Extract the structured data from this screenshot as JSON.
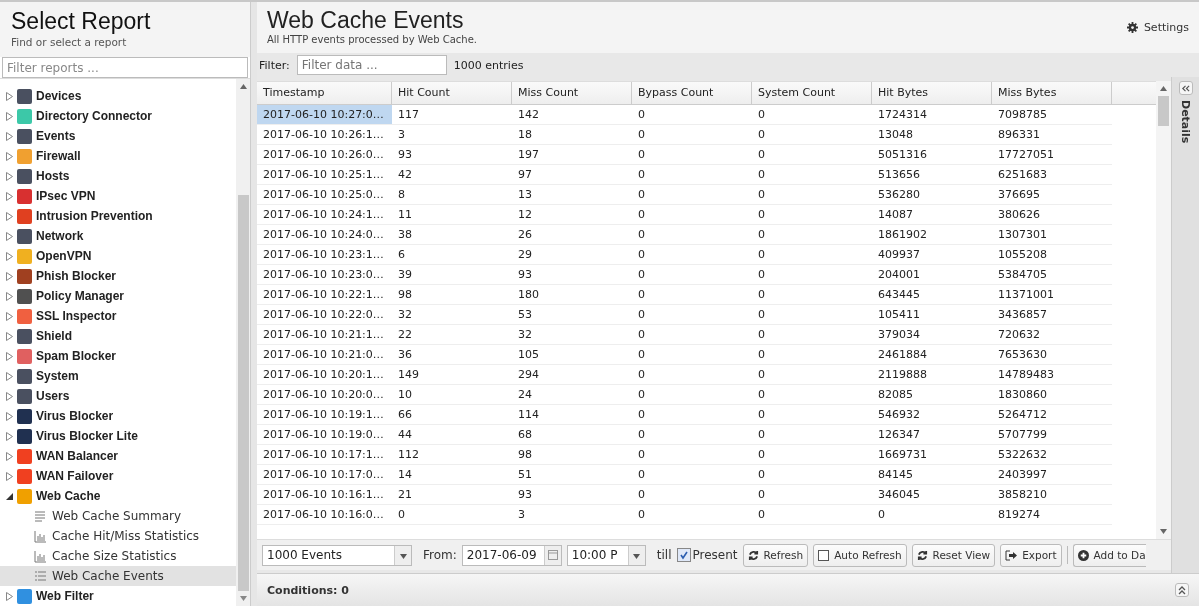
{
  "sidebar": {
    "title": "Select Report",
    "subtitle": "Find or select a report",
    "filter": {
      "placeholder": "Filter reports ..."
    },
    "items": [
      {
        "label": "Devices",
        "color": "#4a5060",
        "expanded": false
      },
      {
        "label": "Directory Connector",
        "color": "#3cc8a8",
        "expanded": false
      },
      {
        "label": "Events",
        "color": "#4a5060",
        "expanded": false
      },
      {
        "label": "Firewall",
        "color": "#f0a030",
        "expanded": false
      },
      {
        "label": "Hosts",
        "color": "#4a5060",
        "expanded": false
      },
      {
        "label": "IPsec VPN",
        "color": "#d83030",
        "expanded": false
      },
      {
        "label": "Intrusion Prevention",
        "color": "#e04020",
        "expanded": false
      },
      {
        "label": "Network",
        "color": "#4a5060",
        "expanded": false
      },
      {
        "label": "OpenVPN",
        "color": "#f0b020",
        "expanded": false
      },
      {
        "label": "Phish Blocker",
        "color": "#a04020",
        "expanded": false
      },
      {
        "label": "Policy Manager",
        "color": "#505050",
        "expanded": false
      },
      {
        "label": "SSL Inspector",
        "color": "#f06040",
        "expanded": false
      },
      {
        "label": "Shield",
        "color": "#4a5060",
        "expanded": false
      },
      {
        "label": "Spam Blocker",
        "color": "#e06060",
        "expanded": false
      },
      {
        "label": "System",
        "color": "#4a5060",
        "expanded": false
      },
      {
        "label": "Users",
        "color": "#4a5060",
        "expanded": false
      },
      {
        "label": "Virus Blocker",
        "color": "#203050",
        "expanded": false
      },
      {
        "label": "Virus Blocker Lite",
        "color": "#203050",
        "expanded": false
      },
      {
        "label": "WAN Balancer",
        "color": "#f04020",
        "expanded": false
      },
      {
        "label": "WAN Failover",
        "color": "#f04020",
        "expanded": false
      },
      {
        "label": "Web Cache",
        "color": "#f0a000",
        "expanded": true,
        "children": [
          {
            "label": "Web Cache Summary",
            "kind": "text",
            "selected": false
          },
          {
            "label": "Cache Hit/Miss Statistics",
            "kind": "chart",
            "selected": false
          },
          {
            "label": "Cache Size Statistics",
            "kind": "chart",
            "selected": false
          },
          {
            "label": "Web Cache Events",
            "kind": "events",
            "selected": true
          }
        ]
      },
      {
        "label": "Web Filter",
        "color": "#3090e0",
        "expanded": false
      }
    ]
  },
  "header": {
    "title": "Web Cache Events",
    "subtitle": "All HTTP events processed by Web Cache.",
    "settings": "Settings"
  },
  "filter_bar": {
    "label": "Filter:",
    "placeholder": "Filter data ...",
    "count": "1000 entries"
  },
  "table": {
    "columns": [
      "Timestamp",
      "Hit Count",
      "Miss Count",
      "Bypass Count",
      "System Count",
      "Hit Bytes",
      "Miss Bytes"
    ],
    "rows": [
      {
        "cells": [
          "2017-06-10 10:27:0…",
          "117",
          "142",
          "0",
          "0",
          "1724314",
          "7098785"
        ],
        "selected": true
      },
      {
        "cells": [
          "2017-06-10 10:26:1…",
          "3",
          "18",
          "0",
          "0",
          "13048",
          "896331"
        ],
        "selected": false
      },
      {
        "cells": [
          "2017-06-10 10:26:0…",
          "93",
          "197",
          "0",
          "0",
          "5051316",
          "17727051"
        ],
        "selected": false
      },
      {
        "cells": [
          "2017-06-10 10:25:1…",
          "42",
          "97",
          "0",
          "0",
          "513656",
          "6251683"
        ],
        "selected": false
      },
      {
        "cells": [
          "2017-06-10 10:25:0…",
          "8",
          "13",
          "0",
          "0",
          "536280",
          "376695"
        ],
        "selected": false
      },
      {
        "cells": [
          "2017-06-10 10:24:1…",
          "11",
          "12",
          "0",
          "0",
          "14087",
          "380626"
        ],
        "selected": false
      },
      {
        "cells": [
          "2017-06-10 10:24:0…",
          "38",
          "26",
          "0",
          "0",
          "1861902",
          "1307301"
        ],
        "selected": false
      },
      {
        "cells": [
          "2017-06-10 10:23:1…",
          "6",
          "29",
          "0",
          "0",
          "409937",
          "1055208"
        ],
        "selected": false
      },
      {
        "cells": [
          "2017-06-10 10:23:0…",
          "39",
          "93",
          "0",
          "0",
          "204001",
          "5384705"
        ],
        "selected": false
      },
      {
        "cells": [
          "2017-06-10 10:22:1…",
          "98",
          "180",
          "0",
          "0",
          "643445",
          "11371001"
        ],
        "selected": false
      },
      {
        "cells": [
          "2017-06-10 10:22:0…",
          "32",
          "53",
          "0",
          "0",
          "105411",
          "3436857"
        ],
        "selected": false
      },
      {
        "cells": [
          "2017-06-10 10:21:1…",
          "22",
          "32",
          "0",
          "0",
          "379034",
          "720632"
        ],
        "selected": false
      },
      {
        "cells": [
          "2017-06-10 10:21:0…",
          "36",
          "105",
          "0",
          "0",
          "2461884",
          "7653630"
        ],
        "selected": false
      },
      {
        "cells": [
          "2017-06-10 10:20:1…",
          "149",
          "294",
          "0",
          "0",
          "2119888",
          "14789483"
        ],
        "selected": false
      },
      {
        "cells": [
          "2017-06-10 10:20:0…",
          "10",
          "24",
          "0",
          "0",
          "82085",
          "1830860"
        ],
        "selected": false
      },
      {
        "cells": [
          "2017-06-10 10:19:1…",
          "66",
          "114",
          "0",
          "0",
          "546932",
          "5264712"
        ],
        "selected": false
      },
      {
        "cells": [
          "2017-06-10 10:19:0…",
          "44",
          "68",
          "0",
          "0",
          "126347",
          "5707799"
        ],
        "selected": false
      },
      {
        "cells": [
          "2017-06-10 10:17:1…",
          "112",
          "98",
          "0",
          "0",
          "1669731",
          "5322632"
        ],
        "selected": false
      },
      {
        "cells": [
          "2017-06-10 10:17:0…",
          "14",
          "51",
          "0",
          "0",
          "84145",
          "2403997"
        ],
        "selected": false
      },
      {
        "cells": [
          "2017-06-10 10:16:1…",
          "21",
          "93",
          "0",
          "0",
          "346045",
          "3858210"
        ],
        "selected": false
      },
      {
        "cells": [
          "2017-06-10 10:16:0…",
          "0",
          "3",
          "0",
          "0",
          "0",
          "819274"
        ],
        "selected": false
      }
    ]
  },
  "toolbar": {
    "limit": "1000 Events",
    "from_label": "From:",
    "date": "2017-06-09",
    "time": "10:00 P",
    "till_label": "till",
    "present": {
      "label": "Present",
      "checked": true
    },
    "buttons": [
      {
        "label": "Refresh",
        "kind": "refresh"
      },
      {
        "label": "Auto Refresh",
        "kind": "toggle",
        "checked": false
      },
      {
        "label": "Reset View",
        "kind": "refresh"
      },
      {
        "label": "Export",
        "kind": "export"
      },
      {
        "label": "Add to Da",
        "kind": "add"
      }
    ]
  },
  "details_panel": {
    "label": "Details"
  },
  "conditions": "Conditions: 0"
}
